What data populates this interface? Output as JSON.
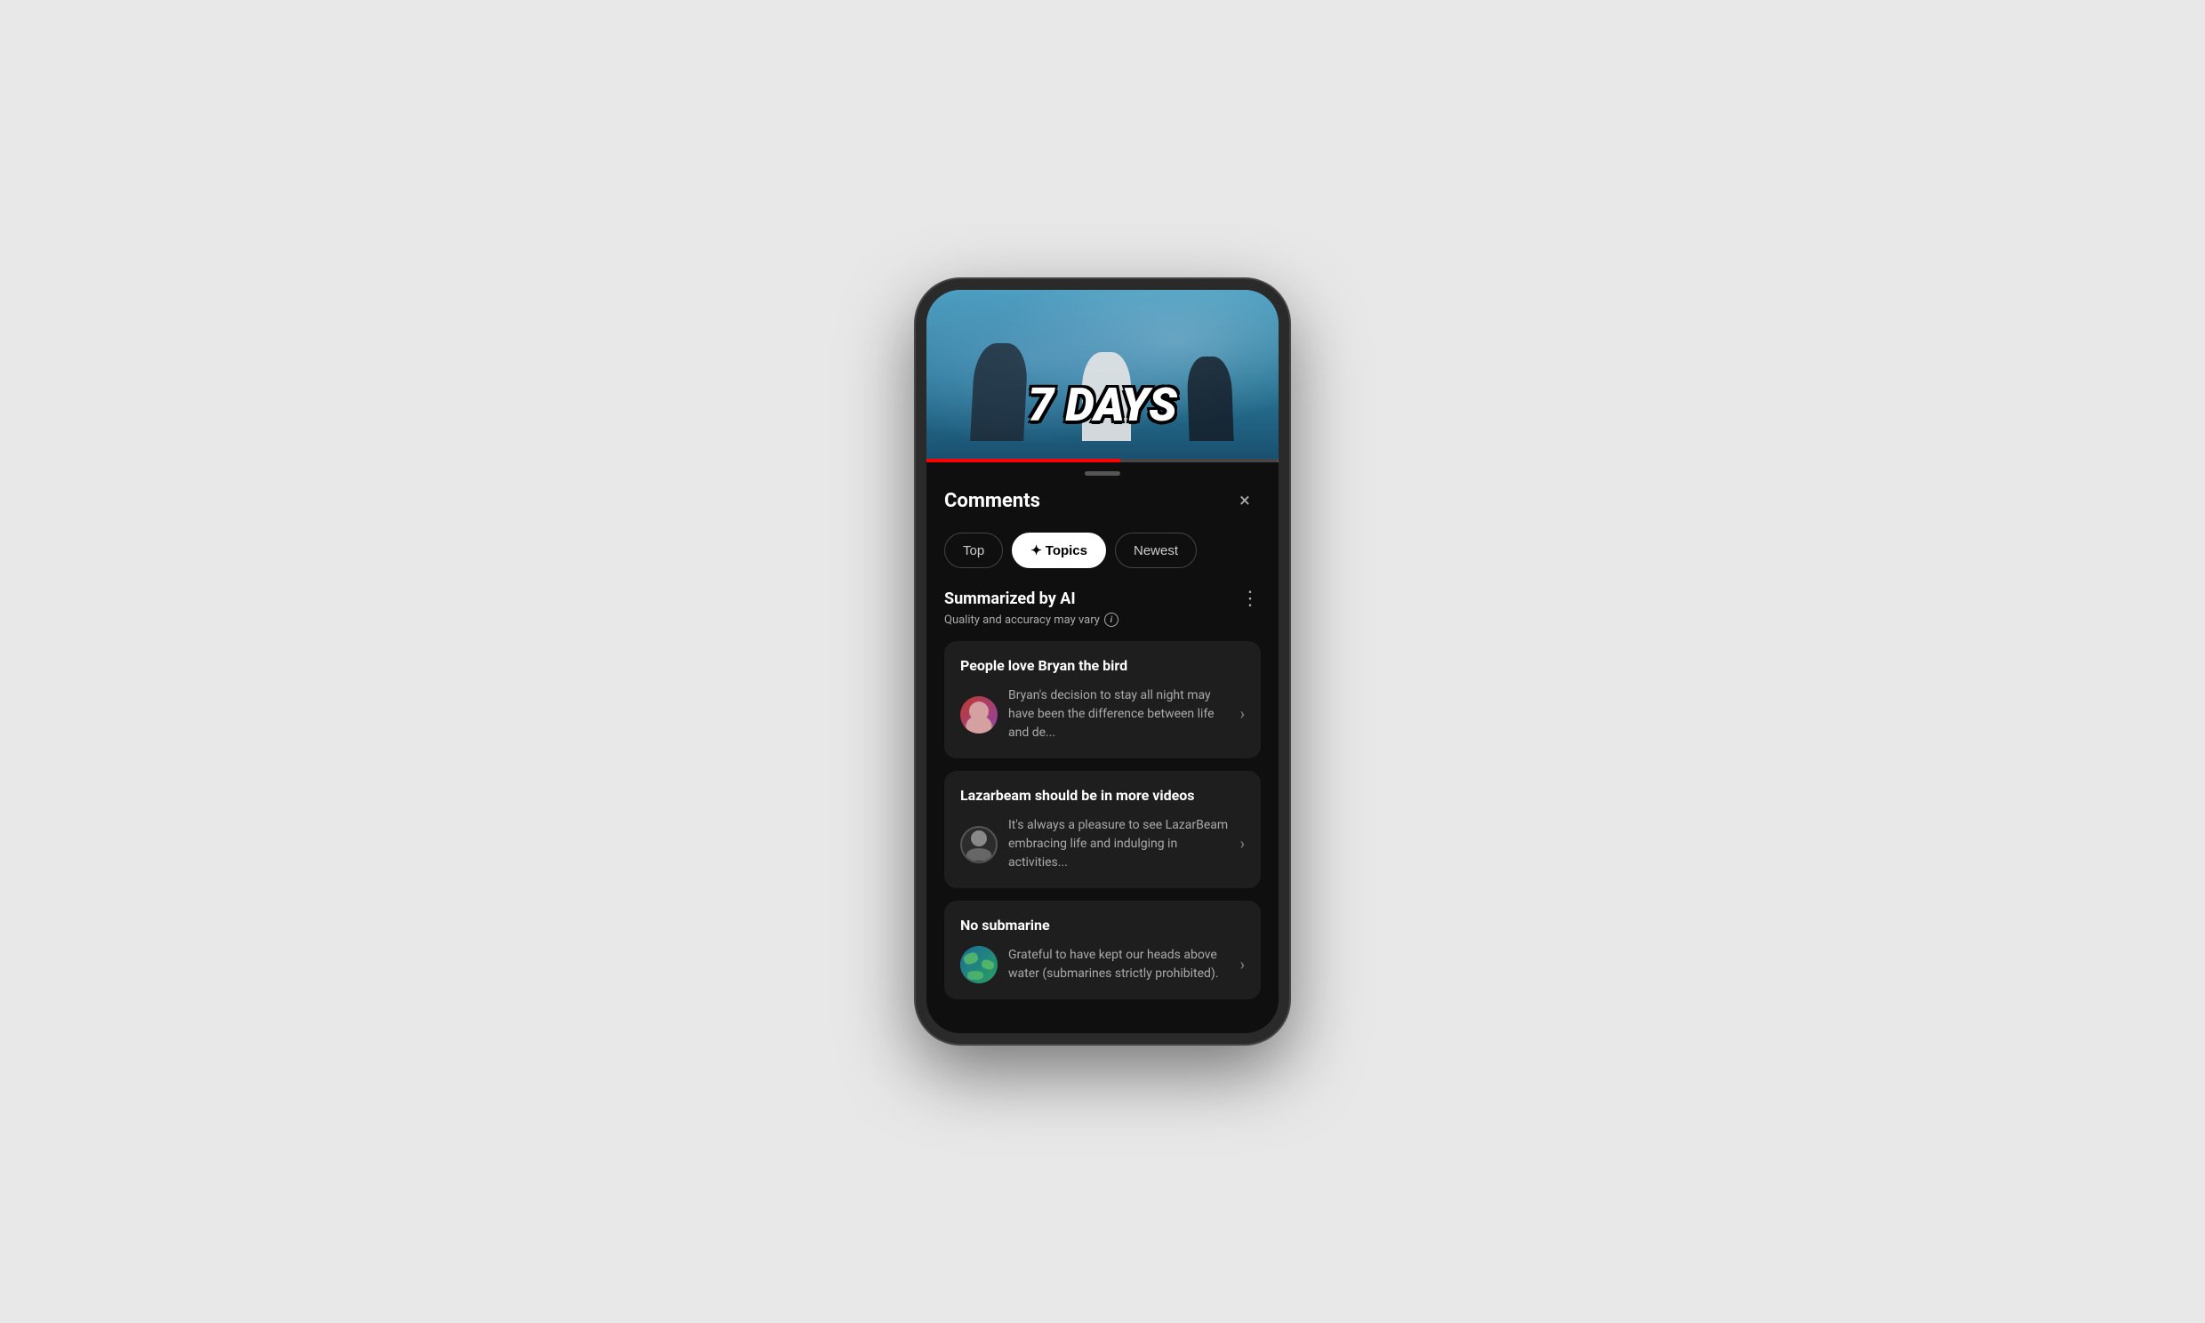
{
  "phone": {
    "video": {
      "text_overlay": "7 DAYS",
      "progress_percent": 55
    },
    "comments": {
      "title": "Comments",
      "close_label": "×",
      "tabs": [
        {
          "id": "top",
          "label": "Top",
          "active": false
        },
        {
          "id": "topics",
          "label": "Topics",
          "active": true,
          "sparkle": "✦"
        },
        {
          "id": "newest",
          "label": "Newest",
          "active": false
        }
      ],
      "ai_summary": {
        "title": "Summarized by AI",
        "subtitle": "Quality and accuracy may vary",
        "more_label": "⋮",
        "info_label": "i"
      },
      "topic_cards": [
        {
          "id": "card-1",
          "title": "People love Bryan the bird",
          "preview_text": "Bryan's decision to stay all night may have been the difference between life and de...",
          "avatar_type": "person"
        },
        {
          "id": "card-2",
          "title": "Lazarbeam should be in more videos",
          "preview_text": "It's always a pleasure to see LazarBeam embracing life and indulging in activities...",
          "avatar_type": "circle"
        },
        {
          "id": "card-3",
          "title": "No submarine",
          "preview_text": "Grateful to have kept our heads above water (submarines strictly prohibited).",
          "avatar_type": "earth"
        }
      ],
      "chevron": "›"
    }
  }
}
